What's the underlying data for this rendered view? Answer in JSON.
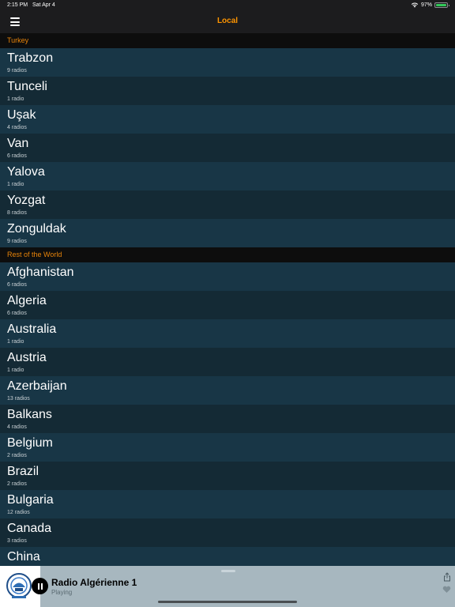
{
  "status_bar": {
    "time": "2:15 PM",
    "date": "Sat Apr 4",
    "battery": "97%",
    "battery_level": 0.97
  },
  "nav": {
    "title": "Local"
  },
  "sections": [
    {
      "header": "Turkey",
      "items": [
        {
          "name": "Trabzon",
          "count": "9 radios"
        },
        {
          "name": "Tunceli",
          "count": "1 radio"
        },
        {
          "name": "Uşak",
          "count": "4 radios"
        },
        {
          "name": "Van",
          "count": "6 radios"
        },
        {
          "name": "Yalova",
          "count": "1 radio"
        },
        {
          "name": "Yozgat",
          "count": "8 radios"
        },
        {
          "name": "Zonguldak",
          "count": "9 radios"
        }
      ]
    },
    {
      "header": "Rest of the World",
      "items": [
        {
          "name": "Afghanistan",
          "count": "6 radios"
        },
        {
          "name": "Algeria",
          "count": "6 radios"
        },
        {
          "name": "Australia",
          "count": "1 radio"
        },
        {
          "name": "Austria",
          "count": "1 radio"
        },
        {
          "name": "Azerbaijan",
          "count": "13 radios"
        },
        {
          "name": "Balkans",
          "count": "4 radios"
        },
        {
          "name": "Belgium",
          "count": "2 radios"
        },
        {
          "name": "Brazil",
          "count": "2 radios"
        },
        {
          "name": "Bulgaria",
          "count": "12 radios"
        },
        {
          "name": "Canada",
          "count": "3 radios"
        },
        {
          "name": "China",
          "count": ""
        }
      ]
    }
  ],
  "player": {
    "station": "Radio Algérienne 1",
    "state": "Playing"
  },
  "icons": {
    "menu": "menu-icon",
    "wifi": "wifi-icon",
    "battery": "battery-icon",
    "pause": "pause-icon",
    "share": "share-icon",
    "heart": "heart-icon",
    "station_logo": "station-logo-icon"
  },
  "colors": {
    "accent": "#ff9500",
    "section_text": "#e8840a",
    "row_a": "#183646",
    "row_b": "#142a35",
    "player_bg": "#a7b7bf"
  }
}
